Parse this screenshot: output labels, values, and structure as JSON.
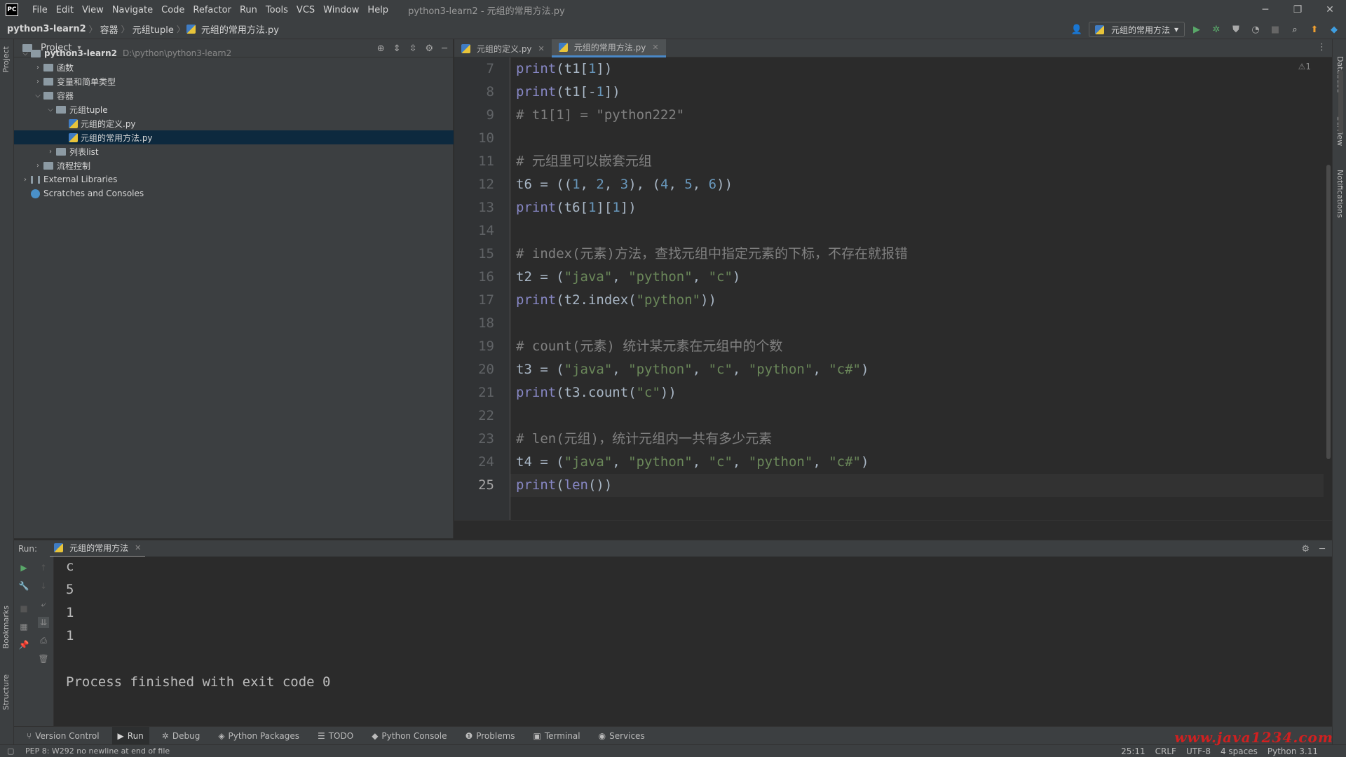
{
  "titlebar": {
    "logo": "PC",
    "menus": [
      "File",
      "Edit",
      "View",
      "Navigate",
      "Code",
      "Refactor",
      "Run",
      "Tools",
      "VCS",
      "Window",
      "Help"
    ],
    "window_title": "python3-learn2 - 元组的常用方法.py",
    "minimize": "─",
    "restore": "❐",
    "close": "✕"
  },
  "navbar": {
    "crumbs": [
      "python3-learn2",
      "容器",
      "元组tuple",
      "元组的常用方法.py"
    ],
    "run_config": "元组的常用方法"
  },
  "project": {
    "title": "Project",
    "tree": [
      {
        "label": "python3-learn2",
        "path": "D:\\python\\python3-learn2",
        "level": 0,
        "type": "folder",
        "expanded": true
      },
      {
        "label": "函数",
        "level": 1,
        "type": "folder",
        "expanded": false
      },
      {
        "label": "变量和简单类型",
        "level": 1,
        "type": "folder",
        "expanded": false
      },
      {
        "label": "容器",
        "level": 1,
        "type": "folder",
        "expanded": true
      },
      {
        "label": "元组tuple",
        "level": 2,
        "type": "folder",
        "expanded": true
      },
      {
        "label": "元组的定义.py",
        "level": 3,
        "type": "py"
      },
      {
        "label": "元组的常用方法.py",
        "level": 3,
        "type": "py",
        "selected": true
      },
      {
        "label": "列表list",
        "level": 2,
        "type": "folder",
        "expanded": false
      },
      {
        "label": "流程控制",
        "level": 1,
        "type": "folder",
        "expanded": false
      },
      {
        "label": "External Libraries",
        "level": 0,
        "type": "lib",
        "expanded": false
      },
      {
        "label": "Scratches and Consoles",
        "level": 0,
        "type": "scratch"
      }
    ]
  },
  "editor": {
    "tabs": [
      {
        "label": "元组的定义.py",
        "active": false
      },
      {
        "label": "元组的常用方法.py",
        "active": true
      }
    ],
    "inspection": "⚠1",
    "current_line": 25,
    "lines": [
      {
        "n": "7",
        "code": "print(t1[1])"
      },
      {
        "n": "8",
        "code": "print(t1[-1])"
      },
      {
        "n": "9",
        "code": "# t1[1] = \"python222\""
      },
      {
        "n": "10",
        "code": ""
      },
      {
        "n": "11",
        "code": "# 元组里可以嵌套元组"
      },
      {
        "n": "12",
        "code": "t6 = ((1, 2, 3), (4, 5, 6))"
      },
      {
        "n": "13",
        "code": "print(t6[1][1])"
      },
      {
        "n": "14",
        "code": ""
      },
      {
        "n": "15",
        "code": "# index(元素)方法，查找元组中指定元素的下标，不存在就报错"
      },
      {
        "n": "16",
        "code": "t2 = (\"java\", \"python\", \"c\")"
      },
      {
        "n": "17",
        "code": "print(t2.index(\"python\"))"
      },
      {
        "n": "18",
        "code": ""
      },
      {
        "n": "19",
        "code": "# count(元素) 统计某元素在元组中的个数"
      },
      {
        "n": "20",
        "code": "t3 = (\"java\", \"python\", \"c\", \"python\", \"c#\")"
      },
      {
        "n": "21",
        "code": "print(t3.count(\"c\"))"
      },
      {
        "n": "22",
        "code": ""
      },
      {
        "n": "23",
        "code": "# len(元组)，统计元组内一共有多少元素"
      },
      {
        "n": "24",
        "code": "t4 = (\"java\", \"python\", \"c\", \"python\", \"c#\")"
      },
      {
        "n": "25",
        "code": "print(len())"
      }
    ]
  },
  "run": {
    "label": "Run:",
    "tab": "元组的常用方法",
    "output": [
      "c",
      "5",
      "1",
      "1",
      "",
      "Process finished with exit code 0"
    ]
  },
  "bottom_tools": [
    {
      "label": "Version Control",
      "icon": "⑂"
    },
    {
      "label": "Run",
      "icon": "▶",
      "active": true
    },
    {
      "label": "Debug",
      "icon": "✲"
    },
    {
      "label": "Python Packages",
      "icon": "◈"
    },
    {
      "label": "TODO",
      "icon": "☰"
    },
    {
      "label": "Python Console",
      "icon": "◆"
    },
    {
      "label": "Problems",
      "icon": "❶"
    },
    {
      "label": "Terminal",
      "icon": "▣"
    },
    {
      "label": "Services",
      "icon": "◉"
    }
  ],
  "status": {
    "message": "PEP 8: W292 no newline at end of file",
    "position": "25:11",
    "line_sep": "CRLF",
    "encoding": "UTF-8",
    "indent": "4 spaces",
    "interpreter": "Python 3.11"
  },
  "side": {
    "left": [
      "Project",
      "Bookmarks",
      "Structure"
    ],
    "right": [
      "Database",
      "SciView",
      "Notifications"
    ]
  },
  "watermark": "www.java1234.com"
}
